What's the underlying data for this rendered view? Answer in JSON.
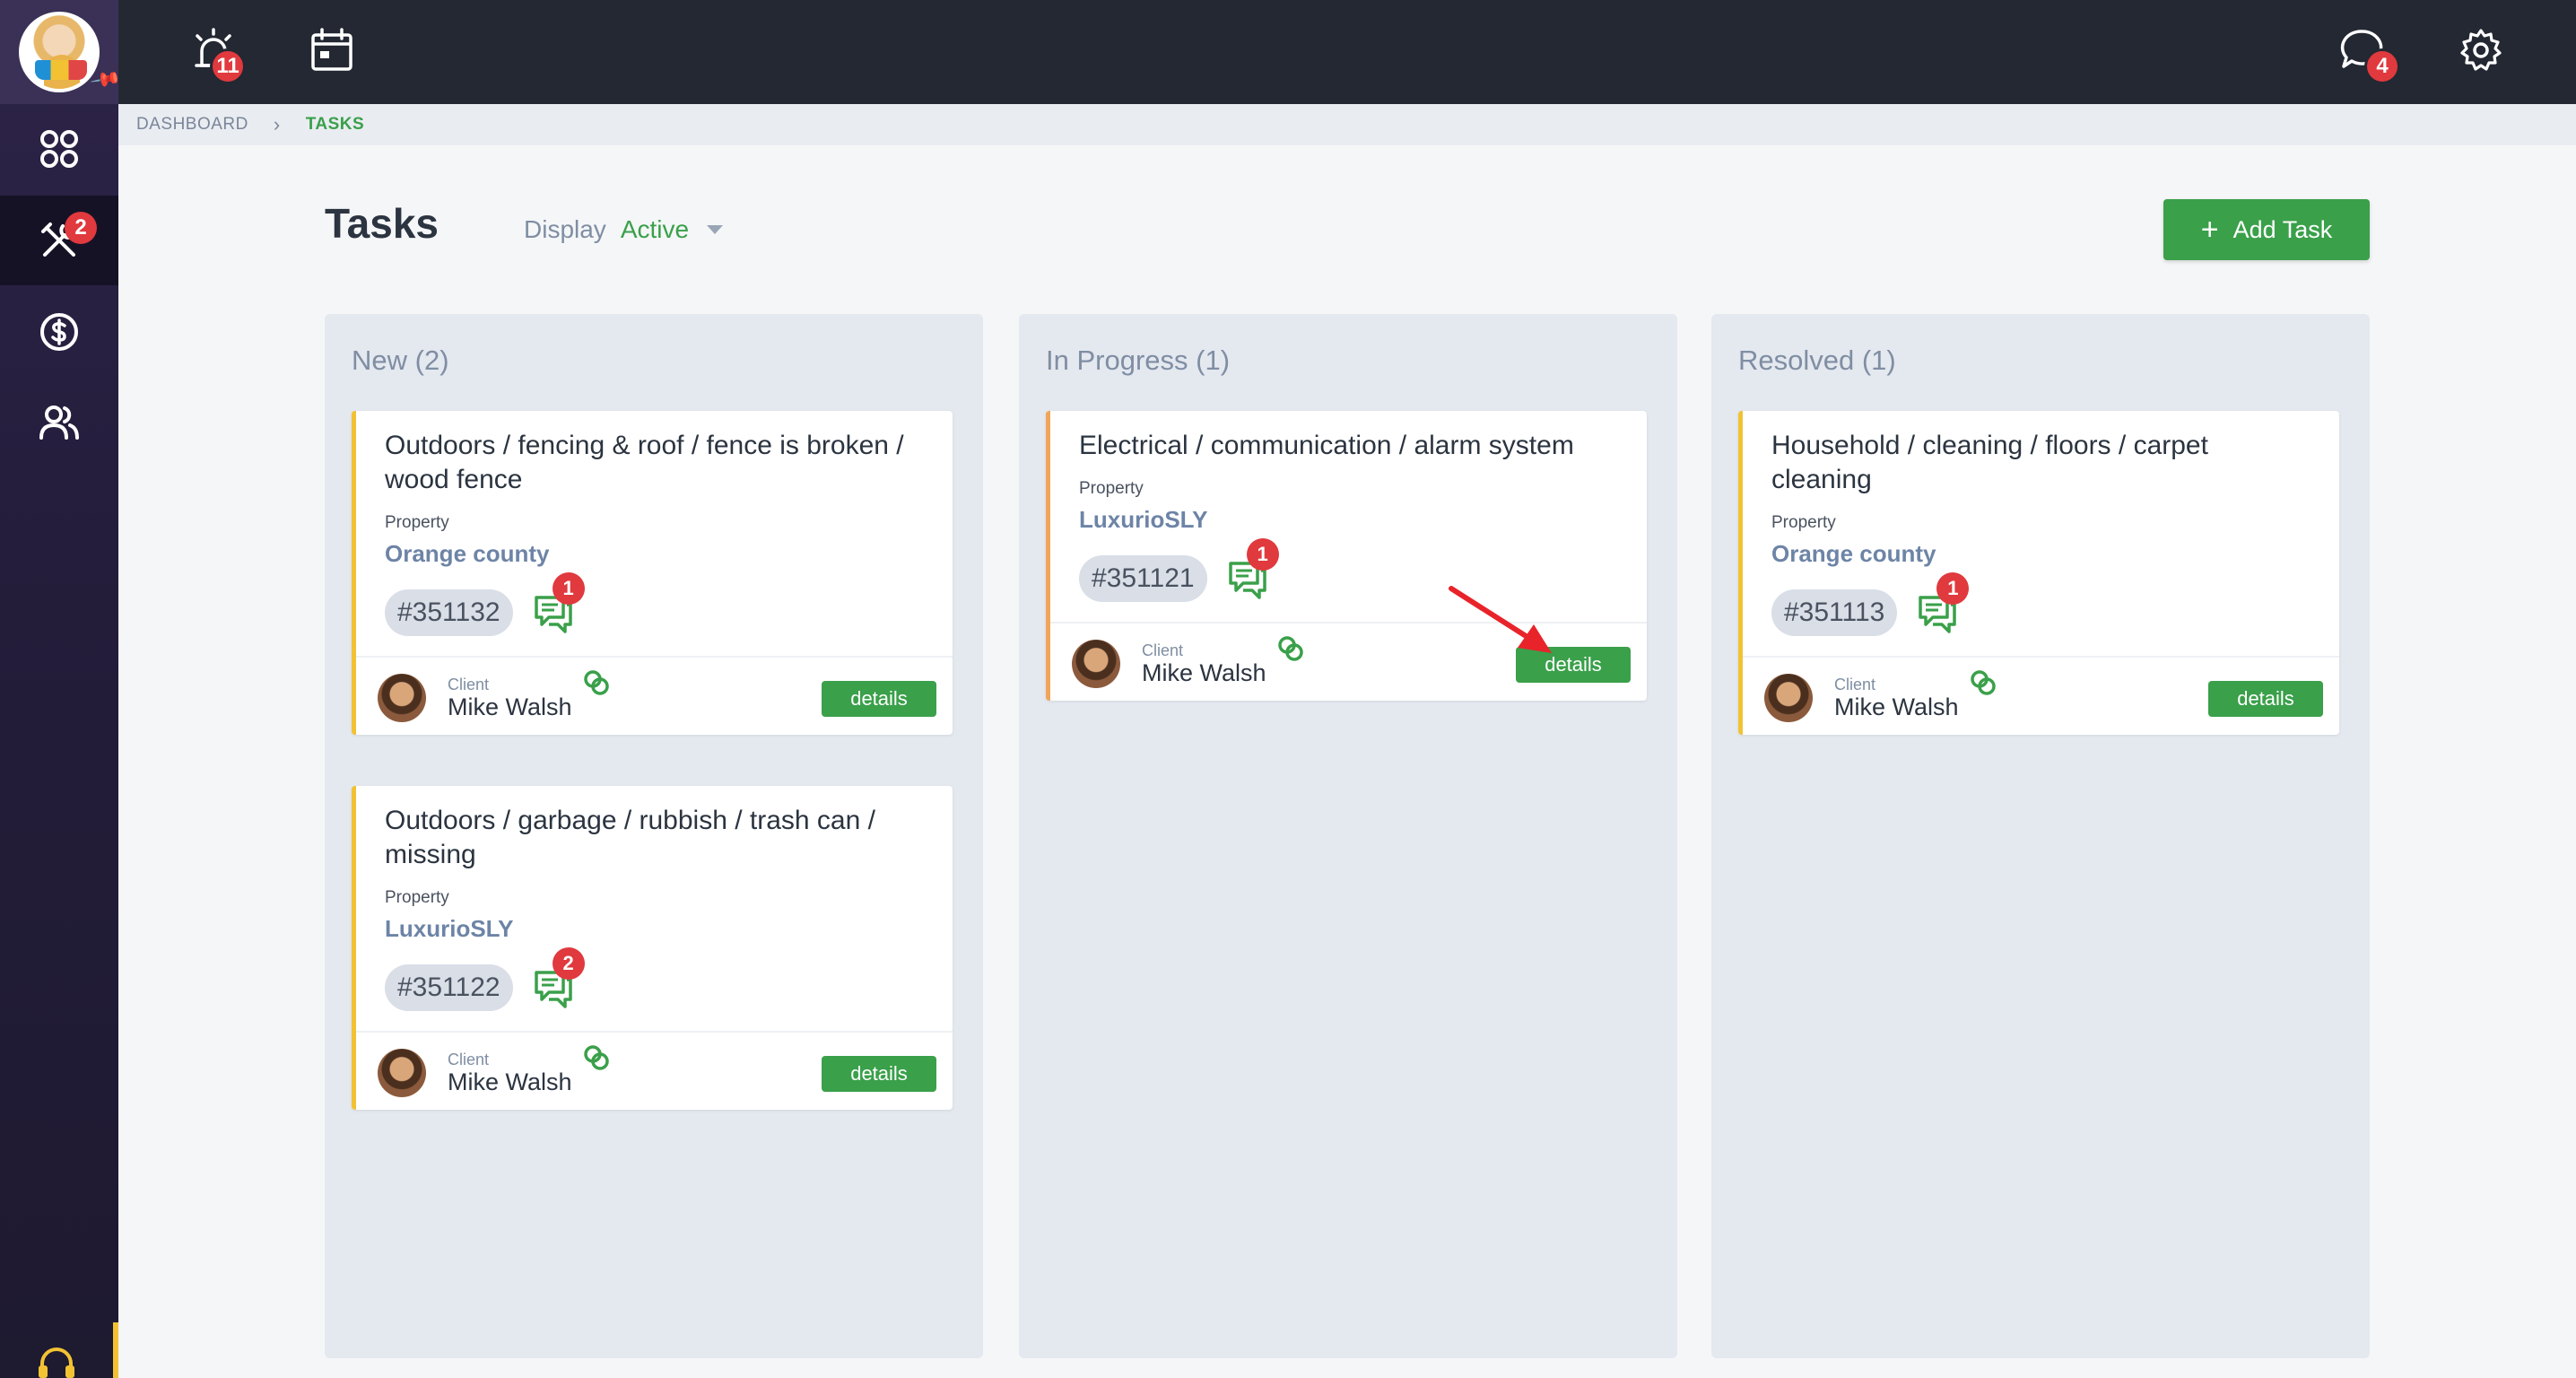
{
  "topbar": {
    "alarm_badge": "11",
    "chat_badge": "4"
  },
  "sidebar": {
    "tools_badge": "2"
  },
  "breadcrumb": {
    "items": [
      "DASHBOARD",
      "TASKS"
    ]
  },
  "header": {
    "title": "Tasks",
    "display_label": "Display",
    "display_value": "Active",
    "add_task_label": "Add Task"
  },
  "columns": [
    {
      "title": "New (2)",
      "cards": [
        {
          "title": "Outdoors / fencing & roof / fence is broken / wood fence",
          "property_label": "Property",
          "property": "Orange county",
          "id": "#351132",
          "messages": "1",
          "client_label": "Client",
          "client": "Mike Walsh",
          "details_label": "details"
        },
        {
          "title": "Outdoors / garbage / rubbish / trash can / missing",
          "property_label": "Property",
          "property": "LuxurioSLY",
          "id": "#351122",
          "messages": "2",
          "client_label": "Client",
          "client": "Mike Walsh",
          "details_label": "details"
        }
      ]
    },
    {
      "title": "In Progress (1)",
      "cards": [
        {
          "title": "Electrical / communication / alarm system",
          "property_label": "Property",
          "property": "LuxurioSLY",
          "id": "#351121",
          "messages": "1",
          "client_label": "Client",
          "client": "Mike Walsh",
          "details_label": "details"
        }
      ]
    },
    {
      "title": "Resolved (1)",
      "cards": [
        {
          "title": "Household / cleaning / floors / carpet cleaning",
          "property_label": "Property",
          "property": "Orange county",
          "id": "#351113",
          "messages": "1",
          "client_label": "Client",
          "client": "Mike Walsh",
          "details_label": "details"
        }
      ]
    }
  ],
  "colors": {
    "accent_green": "#3aa04a",
    "badge_red": "#e0393e",
    "new_border": "#f2c233",
    "in_progress_border": "#f0a65a",
    "sidebar": "#2d2448",
    "topbar": "#232832"
  }
}
